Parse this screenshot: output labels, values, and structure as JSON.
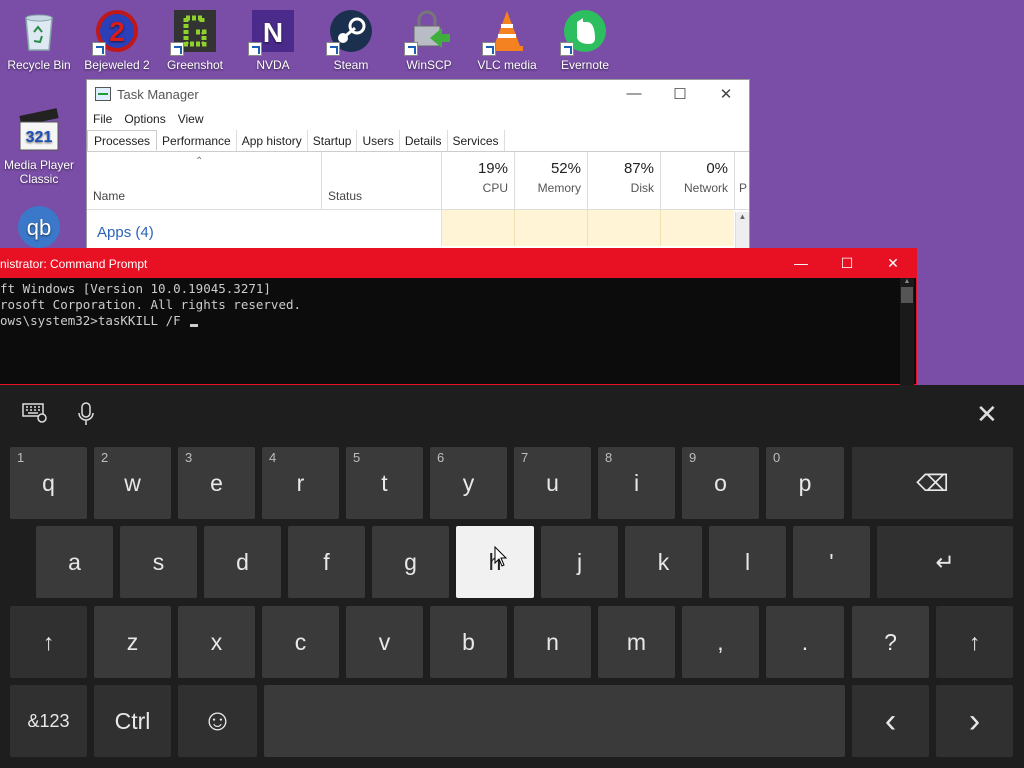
{
  "desktop": {
    "icons": [
      {
        "label": "Recycle Bin",
        "icon": "recycle-bin-icon"
      },
      {
        "label": "Bejeweled 2",
        "icon": "bejeweled-icon"
      },
      {
        "label": "Greenshot",
        "icon": "greenshot-icon"
      },
      {
        "label": "NVDA",
        "icon": "nvda-icon"
      },
      {
        "label": "Steam",
        "icon": "steam-icon"
      },
      {
        "label": "WinSCP",
        "icon": "winscp-icon"
      },
      {
        "label": "VLC media",
        "icon": "vlc-icon"
      },
      {
        "label": "Evernote",
        "icon": "evernote-icon"
      },
      {
        "label": "Media Player Classic",
        "icon": "media-player-classic-icon"
      },
      {
        "label": "",
        "icon": "qbittorrent-icon"
      }
    ],
    "colors": {
      "background": "#7a4ea7"
    }
  },
  "task_manager": {
    "title": "Task Manager",
    "menu": [
      "File",
      "Options",
      "View"
    ],
    "tabs": [
      "Processes",
      "Performance",
      "App history",
      "Startup",
      "Users",
      "Details",
      "Services"
    ],
    "active_tab": "Processes",
    "columns": {
      "name": "Name",
      "status": "Status",
      "cpu": {
        "pct": "19%",
        "label": "CPU"
      },
      "memory": {
        "pct": "52%",
        "label": "Memory"
      },
      "disk": {
        "pct": "87%",
        "label": "Disk"
      },
      "network": {
        "pct": "0%",
        "label": "Network"
      },
      "power": {
        "label": "P"
      }
    },
    "group": "Apps (4)",
    "controls": {
      "minimize": "—",
      "maximize": "☐",
      "close": "✕"
    }
  },
  "command_prompt": {
    "title": "nistrator:  Command Prompt",
    "lines": [
      "ft Windows [Version 10.0.19045.3271]",
      "rosoft Corporation. All rights reserved.",
      "",
      "ows\\system32>tasKKILL /F "
    ],
    "accent": "#e81123",
    "controls": {
      "minimize": "—",
      "maximize": "☐",
      "close": "✕"
    }
  },
  "keyboard": {
    "top_icons": {
      "keyboard_settings": "keyboard-settings-icon",
      "microphone": "microphone-icon",
      "close": "✕"
    },
    "row1": [
      {
        "label": "q",
        "hint": "1"
      },
      {
        "label": "w",
        "hint": "2"
      },
      {
        "label": "e",
        "hint": "3"
      },
      {
        "label": "r",
        "hint": "4"
      },
      {
        "label": "t",
        "hint": "5"
      },
      {
        "label": "y",
        "hint": "6"
      },
      {
        "label": "u",
        "hint": "7"
      },
      {
        "label": "i",
        "hint": "8"
      },
      {
        "label": "o",
        "hint": "9"
      },
      {
        "label": "p",
        "hint": "0"
      }
    ],
    "backspace": "⌫",
    "row2": [
      "a",
      "s",
      "d",
      "f",
      "g",
      "h",
      "j",
      "k",
      "l",
      "'"
    ],
    "pressed_key": "h",
    "enter": "↵",
    "row3": [
      "z",
      "x",
      "c",
      "v",
      "b",
      "n",
      "m",
      ",",
      ".",
      "?"
    ],
    "shift": "↑",
    "row4": {
      "symbols": "&123",
      "ctrl": "Ctrl",
      "emoji": "☺",
      "left": "‹",
      "right": "›"
    }
  }
}
